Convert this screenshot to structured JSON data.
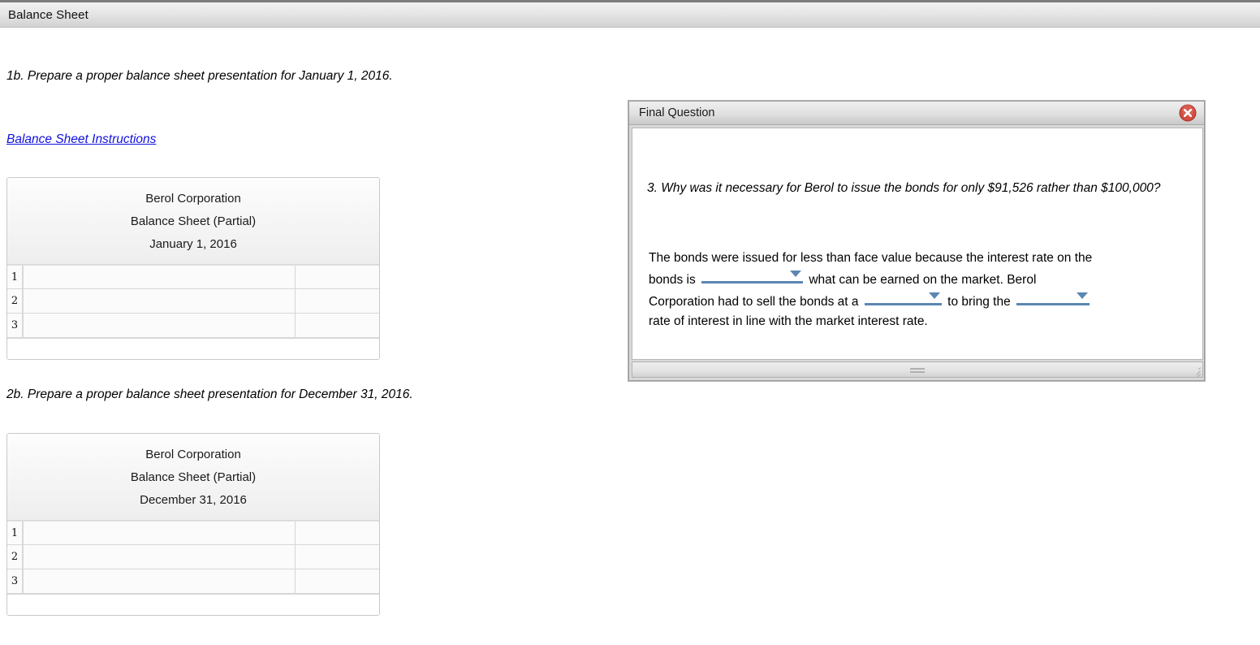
{
  "app": {
    "title": "Balance Sheet"
  },
  "page": {
    "prompt_1": "1b. Prepare a proper balance sheet presentation for January 1, 2016.",
    "prompt_2": "2b. Prepare a proper balance sheet presentation for December 31, 2016.",
    "instructions_link": "Balance Sheet Instructions"
  },
  "sheets": [
    {
      "company": "Berol Corporation",
      "statement": "Balance Sheet (Partial)",
      "date": "January 1, 2016",
      "rows": [
        {
          "num": "1",
          "description": "",
          "amount": ""
        },
        {
          "num": "2",
          "description": "",
          "amount": ""
        },
        {
          "num": "3",
          "description": "",
          "amount": ""
        }
      ]
    },
    {
      "company": "Berol Corporation",
      "statement": "Balance Sheet (Partial)",
      "date": "December 31, 2016",
      "rows": [
        {
          "num": "1",
          "description": "",
          "amount": ""
        },
        {
          "num": "2",
          "description": "",
          "amount": ""
        },
        {
          "num": "3",
          "description": "",
          "amount": ""
        }
      ]
    }
  ],
  "dialog": {
    "title": "Final Question",
    "close_icon": "close-circle-icon",
    "question": "3. Why was it necessary for Berol to issue the bonds for only $91,526 rather than $100,000?",
    "answer": {
      "part_1": "The bonds were issued for less than face value because the interest rate on the bonds is",
      "dropdown_1_value": "",
      "part_2": "what can be earned on the market. Berol Corporation had to sell the bonds at a",
      "dropdown_2_value": "",
      "part_3": "to bring the",
      "dropdown_3_value": "",
      "part_4": "rate of interest in line with the market interest rate."
    }
  },
  "colors": {
    "link": "#1111dd",
    "dropdown_accent": "#5b87b2",
    "close_button": "#d24b40",
    "header_bg": "#e6e6e6"
  }
}
